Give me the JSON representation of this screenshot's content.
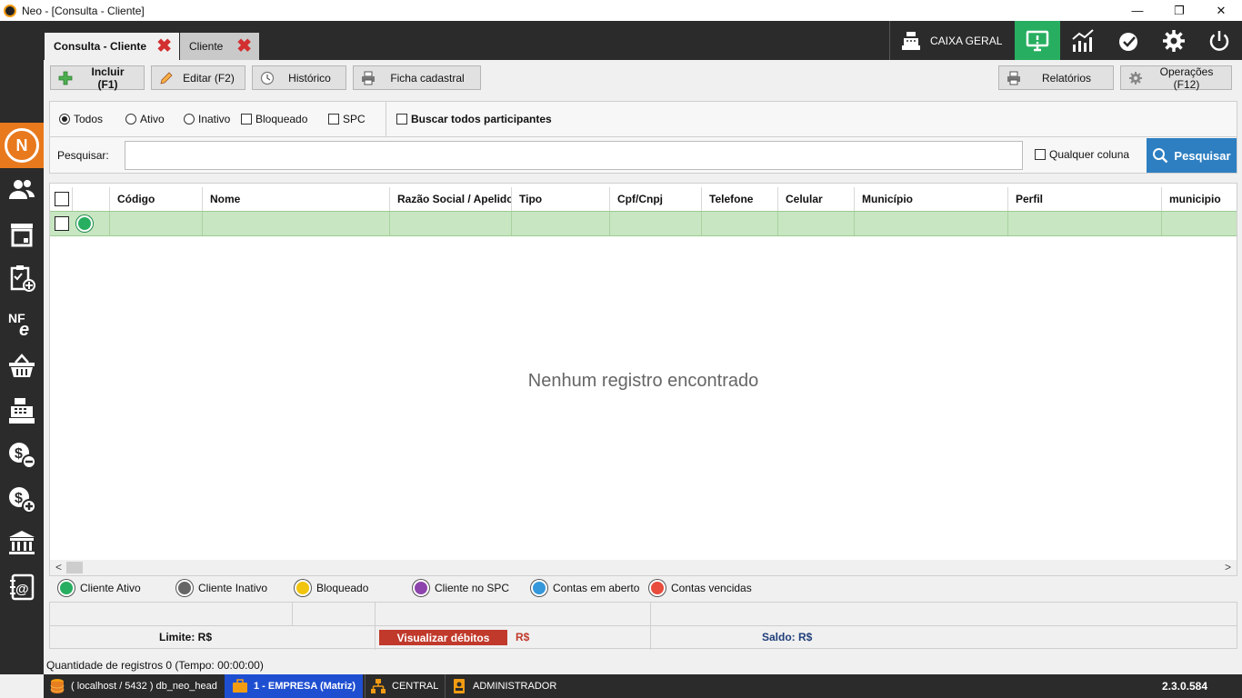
{
  "window": {
    "title": "Neo - [Consulta - Cliente]",
    "minimize": "—",
    "restore": "❐",
    "close": "✕"
  },
  "tabs": [
    {
      "label": "Consulta - Cliente",
      "close": "✖"
    },
    {
      "label": "Cliente",
      "close": "✖"
    }
  ],
  "topbar": {
    "caixa_label": "CAIXA GERAL",
    "icons": [
      "monitor-icon",
      "chart-icon",
      "check-badge-icon",
      "gear-icon",
      "power-icon"
    ]
  },
  "sidebar": {
    "logo_letter": "N",
    "items": [
      "users-icon",
      "warehouse-icon",
      "clipboard-add-icon",
      "nfe-icon",
      "basket-icon",
      "cash-register-icon",
      "money-minus-icon",
      "money-plus-icon",
      "bank-icon",
      "contacts-icon"
    ]
  },
  "toolbar": {
    "incluir": "Incluir (F1)",
    "editar": "Editar (F2)",
    "historico": "Histórico",
    "ficha": "Ficha cadastral",
    "relatorios": "Relatórios",
    "operacoes": "Operações (F12)"
  },
  "filters": {
    "todos": "Todos",
    "ativo": "Ativo",
    "inativo": "Inativo",
    "bloqueado": "Bloqueado",
    "spc": "SPC",
    "buscar_todos": "Buscar todos participantes"
  },
  "search": {
    "label": "Pesquisar:",
    "value": "",
    "qualquer_coluna": "Qualquer coluna",
    "button": "Pesquisar"
  },
  "grid": {
    "columns": [
      "Código",
      "Nome",
      "Razão Social / Apelido",
      "Tipo",
      "Cpf/Cnpj",
      "Telefone",
      "Celular",
      "Município",
      "Perfil",
      "municipio"
    ],
    "empty_message": "Nenhum registro encontrado"
  },
  "legend": [
    {
      "label": "Cliente Ativo",
      "color": "#27ae60"
    },
    {
      "label": "Cliente Inativo",
      "color": "#666666"
    },
    {
      "label": "Bloqueado",
      "color": "#f1c40f"
    },
    {
      "label": "Cliente no SPC",
      "color": "#8e44ad"
    },
    {
      "label": "Contas em aberto",
      "color": "#3498db"
    },
    {
      "label": "Contas vencidas",
      "color": "#e74c3c"
    }
  ],
  "totals": {
    "limite": "Limite: R$",
    "visualizar_debitos": "Visualizar débitos",
    "debito_rs": "R$",
    "saldo": "Saldo: R$"
  },
  "quantidade": "Quantidade de registros 0 (Tempo: 00:00:00)",
  "statusbar": {
    "db": "( localhost / 5432 ) db_neo_head",
    "empresa": "1 - EMPRESA (Matriz)",
    "central": "CENTRAL",
    "usuario": "ADMINISTRADOR",
    "version": "2.3.0.584"
  }
}
